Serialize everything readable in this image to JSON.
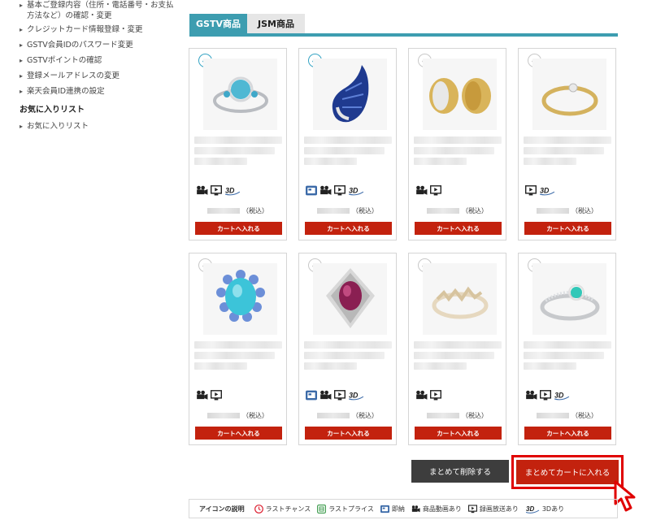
{
  "sidebar": {
    "links": [
      "基本ご登録内容（住所・電話番号・お支払方法など）の確認・変更",
      "クレジットカード情報登録・変更",
      "GSTV会員IDのパスワード変更",
      "GSTVポイントの確認",
      "登録メールアドレスの変更",
      "楽天会員ID連携の設定"
    ],
    "favorites_heading": "お気に入りリスト",
    "favorites_link": "お気に入りリスト"
  },
  "tabs": {
    "gstv": "GSTV商品",
    "jsm": "JSM商品"
  },
  "product_common": {
    "tax_label": "（税込）",
    "cart_button": "カートへ入れる"
  },
  "products": [
    {
      "checked": true,
      "icons": [
        "camera-icon",
        "tv-icon",
        "3d-icon"
      ],
      "image": "blue-gem-ring"
    },
    {
      "checked": true,
      "icons": [
        "news-icon",
        "camera-icon",
        "tv-icon",
        "3d-icon"
      ],
      "image": "sapphire-pendant"
    },
    {
      "checked": false,
      "icons": [
        "camera-icon",
        "tv-icon"
      ],
      "image": "gold-earrings"
    },
    {
      "checked": false,
      "icons": [
        "tv-icon",
        "3d-icon"
      ],
      "image": "gold-ring"
    },
    {
      "checked": false,
      "icons": [
        "camera-icon",
        "tv-icon"
      ],
      "image": "turquoise-ring"
    },
    {
      "checked": false,
      "icons": [
        "news-icon",
        "camera-icon",
        "tv-icon",
        "3d-icon"
      ],
      "image": "ruby-ring"
    },
    {
      "checked": false,
      "icons": [
        "camera-icon",
        "tv-icon"
      ],
      "image": "zigzag-ring"
    },
    {
      "checked": false,
      "icons": [
        "camera-icon",
        "tv-icon",
        "3d-icon"
      ],
      "image": "paraiba-ring"
    }
  ],
  "buttons": {
    "delete_all": "まとめて削除する",
    "add_all_to_cart": "まとめてカートに入れる"
  },
  "legend": {
    "title": "アイコンの説明",
    "items": [
      {
        "icon": "last-chance-icon",
        "label": "ラストチャンス"
      },
      {
        "icon": "last-price-icon",
        "label": "ラストプライス"
      },
      {
        "icon": "news-icon",
        "label": "即納"
      },
      {
        "icon": "camera-icon",
        "label": "商品動画あり"
      },
      {
        "icon": "tv-icon",
        "label": "録画放送あり"
      },
      {
        "icon": "3d-icon",
        "label": "3Dあり"
      }
    ]
  },
  "colors": {
    "accent": "#3d9db0",
    "cart_red": "#c3220e",
    "highlight_red": "#e00000",
    "dark_button": "#3d3d3d"
  }
}
